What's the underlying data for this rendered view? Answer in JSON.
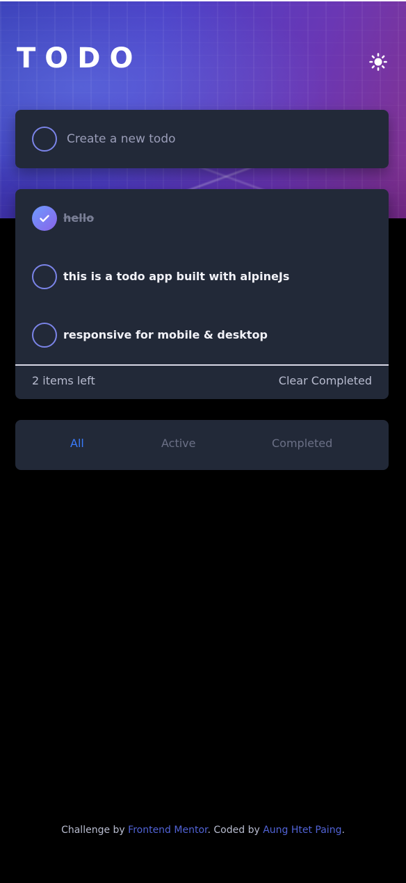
{
  "app": {
    "title": "TODO"
  },
  "theme_toggle": {
    "icon": "sun-icon"
  },
  "create": {
    "placeholder": "Create a new todo",
    "value": ""
  },
  "todos": [
    {
      "text": "hello",
      "completed": true
    },
    {
      "text": "this is a todo app built with alpineJs",
      "completed": false
    },
    {
      "text": "responsive for mobile & desktop",
      "completed": false
    }
  ],
  "list_footer": {
    "items_left": "2 items left",
    "clear_label": "Clear Completed"
  },
  "filters": {
    "all": "All",
    "active": "Active",
    "completed": "Completed",
    "selected": "All"
  },
  "footer": {
    "prefix": "Challenge by",
    "link1": "Frontend Mentor",
    "middle": ". Coded by",
    "link2": "Aung Htet Paing",
    "suffix": "."
  },
  "colors": {
    "background": "#000000",
    "card": "#222938",
    "accent": "#3a7bfd",
    "check_gradient_start": "#6d9bff",
    "check_gradient_end": "#8a63e8",
    "footer_link": "#5163d6"
  }
}
